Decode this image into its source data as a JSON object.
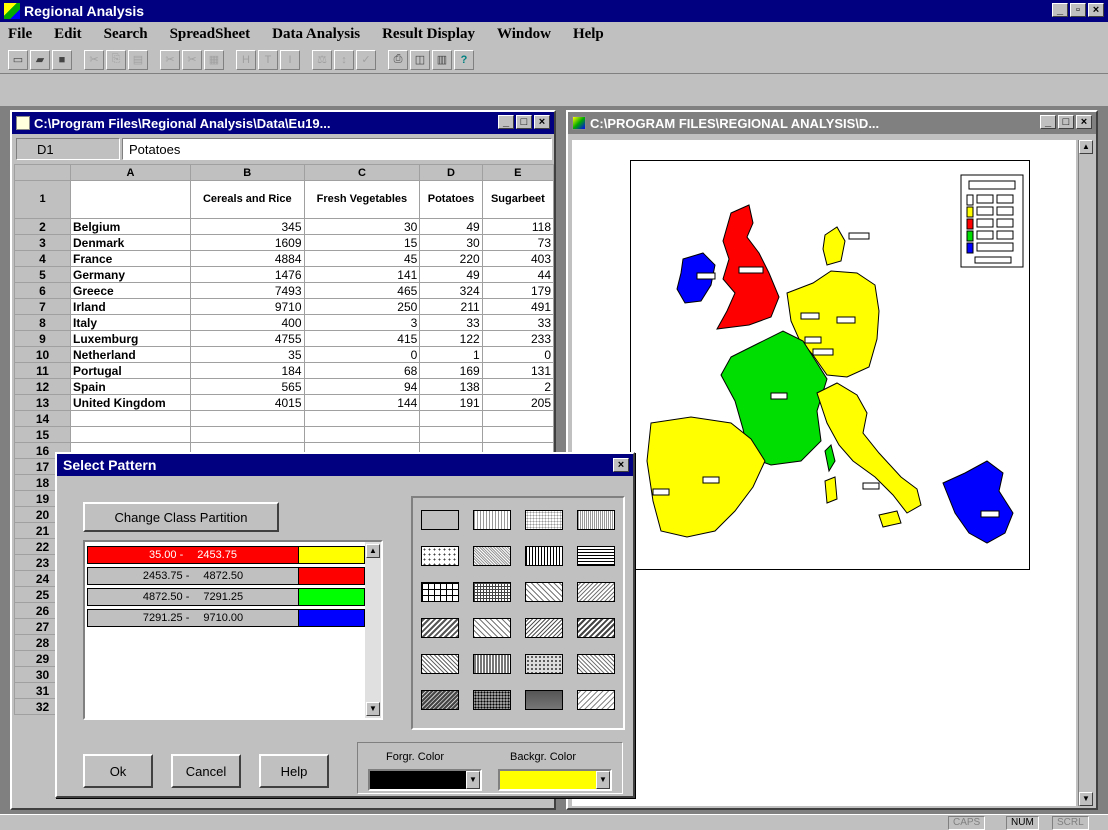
{
  "app": {
    "title": "Regional Analysis"
  },
  "menu": [
    "File",
    "Edit",
    "Search",
    "SpreadSheet",
    "Data Analysis",
    "Result Display",
    "Window",
    "Help"
  ],
  "toolbar": {
    "help_glyph": "?"
  },
  "sheet": {
    "title": "C:\\Program Files\\Regional Analysis\\Data\\Eu19...",
    "cell_ref": "D1",
    "cell_value": "Potatoes",
    "columns": [
      "A",
      "B",
      "C",
      "D",
      "E"
    ],
    "headers": [
      "",
      "Cereals and Rice",
      "Fresh Vegetables",
      "Potatoes",
      "Sugarbeet"
    ],
    "rows": [
      {
        "n": "2",
        "name": "Belgium",
        "b": "345",
        "c": "30",
        "d": "49",
        "e": "118"
      },
      {
        "n": "3",
        "name": "Denmark",
        "b": "1609",
        "c": "15",
        "d": "30",
        "e": "73"
      },
      {
        "n": "4",
        "name": "France",
        "b": "4884",
        "c": "45",
        "d": "220",
        "e": "403"
      },
      {
        "n": "5",
        "name": "Germany",
        "b": "1476",
        "c": "141",
        "d": "49",
        "e": "44"
      },
      {
        "n": "6",
        "name": "Greece",
        "b": "7493",
        "c": "465",
        "d": "324",
        "e": "179"
      },
      {
        "n": "7",
        "name": "Irland",
        "b": "9710",
        "c": "250",
        "d": "211",
        "e": "491"
      },
      {
        "n": "8",
        "name": "Italy",
        "b": "400",
        "c": "3",
        "d": "33",
        "e": "33"
      },
      {
        "n": "9",
        "name": "Luxemburg",
        "b": "4755",
        "c": "415",
        "d": "122",
        "e": "233"
      },
      {
        "n": "10",
        "name": "Netherland",
        "b": "35",
        "c": "0",
        "d": "1",
        "e": "0"
      },
      {
        "n": "11",
        "name": "Portugal",
        "b": "184",
        "c": "68",
        "d": "169",
        "e": "131"
      },
      {
        "n": "12",
        "name": "Spain",
        "b": "565",
        "c": "94",
        "d": "138",
        "e": "2"
      },
      {
        "n": "13",
        "name": "United Kingdom",
        "b": "4015",
        "c": "144",
        "d": "191",
        "e": "205"
      }
    ],
    "extra_rows": [
      "14",
      "15",
      "16",
      "17",
      "18",
      "19",
      "20",
      "21",
      "22",
      "23",
      "24",
      "25",
      "26",
      "27",
      "28",
      "29",
      "30",
      "31",
      "32"
    ],
    "row1": "1"
  },
  "map": {
    "title": "C:\\PROGRAM FILES\\REGIONAL ANALYSIS\\D..."
  },
  "dialog": {
    "title": "Select Pattern",
    "change_button": "Change Class Partition",
    "classes": [
      {
        "from": "35.00 -",
        "to": "2453.75",
        "color": "#ffff00",
        "selected": true
      },
      {
        "from": "2453.75 -",
        "to": "4872.50",
        "color": "#ff0000",
        "selected": false
      },
      {
        "from": "4872.50 -",
        "to": "7291.25",
        "color": "#00ff00",
        "selected": false
      },
      {
        "from": "7291.25 -",
        "to": "9710.00",
        "color": "#0000ff",
        "selected": false
      }
    ],
    "ok": "Ok",
    "cancel": "Cancel",
    "help": "Help",
    "fore_label": "Forgr. Color",
    "back_label": "Backgr. Color",
    "fore_color": "#000000",
    "back_color": "#ffff00"
  },
  "status": {
    "caps": "CAPS",
    "num": "NUM",
    "scrl": "SCRL"
  }
}
